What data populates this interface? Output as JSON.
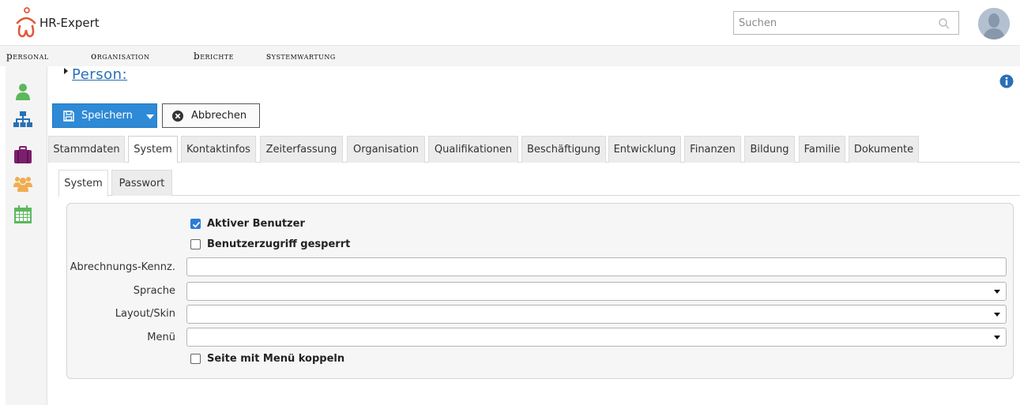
{
  "app": {
    "title": "HR-Expert"
  },
  "search": {
    "placeholder": "Suchen"
  },
  "menu": [
    {
      "cap": "P",
      "rest": "ersonal"
    },
    {
      "cap": "O",
      "rest": "rganisation"
    },
    {
      "cap": "B",
      "rest": "erichte"
    },
    {
      "cap": "S",
      "rest": "ystemwartung"
    }
  ],
  "page": {
    "title": "Person:"
  },
  "buttons": {
    "save": "Speichern",
    "cancel": "Abbrechen"
  },
  "tabs": [
    "Stammdaten",
    "System",
    "Kontaktinfos",
    "Zeiterfassung",
    "Organisation",
    "Qualifikationen",
    "Beschäftigung",
    "Entwicklung",
    "Finanzen",
    "Bildung",
    "Familie",
    "Dokumente"
  ],
  "active_tab": "System",
  "subtabs": [
    "System",
    "Passwort"
  ],
  "active_subtab": "System",
  "form": {
    "aktiver_benutzer": {
      "label": "Aktiver Benutzer",
      "checked": true
    },
    "zugriff_gesperrt": {
      "label": "Benutzerzugriff gesperrt",
      "checked": false
    },
    "abrechnungs_kennz": {
      "label": "Abrechnungs-Kennz.",
      "value": ""
    },
    "sprache": {
      "label": "Sprache",
      "value": ""
    },
    "layout_skin": {
      "label": "Layout/Skin",
      "value": ""
    },
    "menue": {
      "label": "Menü",
      "value": ""
    },
    "seite_koppeln": {
      "label": "Seite mit Menü koppeln",
      "checked": false
    }
  },
  "colors": {
    "accent": "#2e8ad6",
    "link": "#2a6fb6",
    "checkbox": "#2e7bd6"
  }
}
